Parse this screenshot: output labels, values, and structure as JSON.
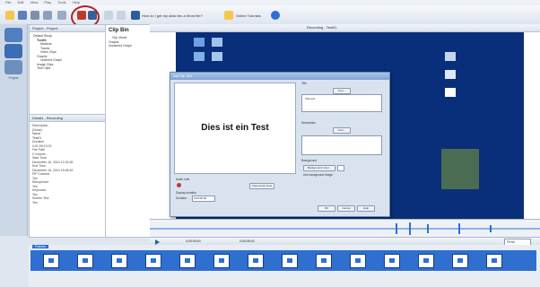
{
  "menubar": {
    "items": [
      "File",
      "Edit",
      "View",
      "Play",
      "Tools",
      "Help"
    ]
  },
  "toolbar": {
    "link1_label": "How do I get my data into a Word file?",
    "link2_label": "Online Tutorials",
    "accent": "#b0222a"
  },
  "left_rail": {
    "items": [
      {
        "label": "Project",
        "icon": "project-icon"
      }
    ]
  },
  "project_tree": {
    "title": "Project - Project",
    "items": [
      "Default Study",
      "Test01",
      "Markers",
      "Tracks",
      "Video Clips",
      "Graphs",
      "Untimed Graph",
      "Image Clips",
      "Text Clips"
    ]
  },
  "details": {
    "title": "Details - Recording",
    "props": [
      "Description",
      "(None)",
      "Name",
      "Test01",
      "Duration",
      "0:01:05:12:00",
      "File Path",
      "C:\\Users\\...",
      "Start Time",
      "December 16, 2010 12:03:35",
      "End Time",
      "December 16, 2010 16:06:49",
      "PIP Camera",
      "Yes",
      "Microphone",
      "Yes",
      "Keyboard",
      "Yes",
      "Screen Text",
      "Yes"
    ]
  },
  "clip_bin": {
    "title": "Clip Bin",
    "items": [
      "Clip Views",
      "Graphs",
      "Unnamed Graph"
    ]
  },
  "canvas": {
    "title": "Recording - Test01"
  },
  "dialog": {
    "title": "Add Clip Text",
    "preview_text": "Dies ist ein Test",
    "title_label": "Title",
    "title_value": "Title text",
    "description_label": "Description",
    "font_button": "Font...",
    "background_label": "Background",
    "bg_color_button": "Background Color...",
    "bg_image_label": "Use background image",
    "audio_label": "Audio note",
    "clear_audio_button": "Clear Audio Note",
    "display_label": "Display duration",
    "duration_label": "Duration",
    "duration_value": "0:00:05.00",
    "ok": "OK",
    "cancel": "Cancel",
    "help": "Help"
  },
  "playbar": {
    "time1": "0:00:00:00",
    "time2": "0:00:05:00",
    "zoom": "Fit All"
  },
  "track": {
    "label": "Frames"
  }
}
